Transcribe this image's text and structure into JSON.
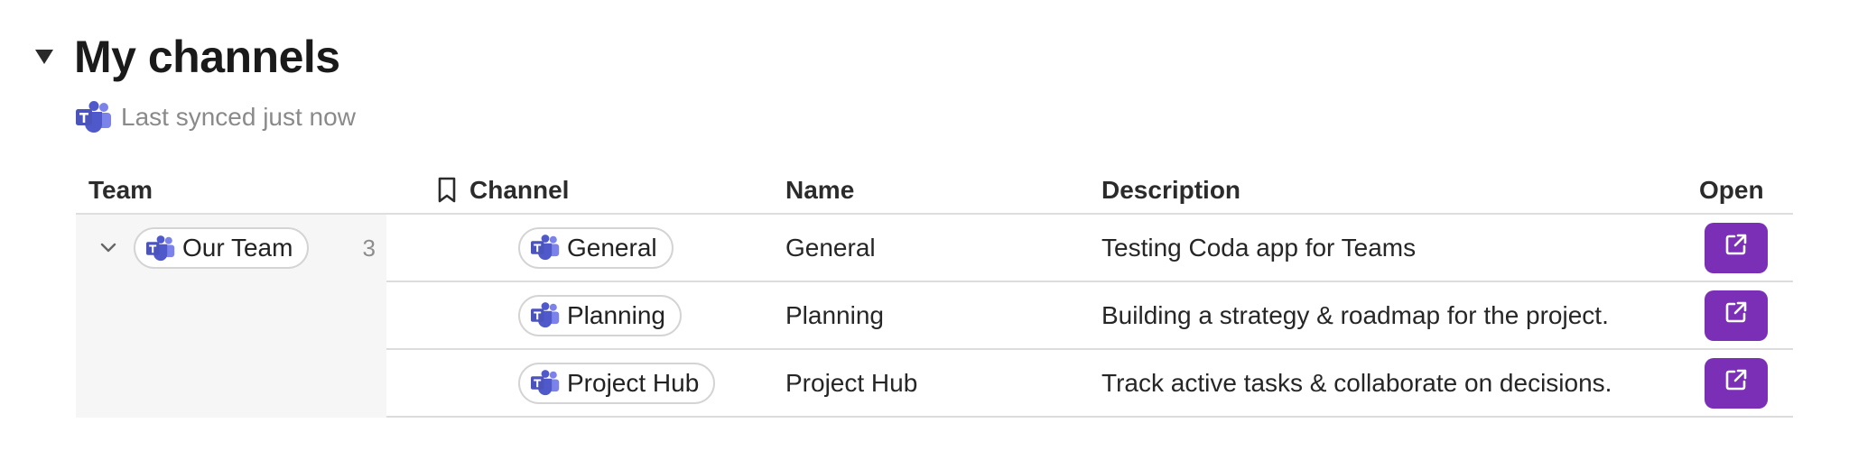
{
  "section": {
    "title": "My channels",
    "sync_status": "Last synced just now",
    "collapse_icon": "triangle-down-icon"
  },
  "colors": {
    "accent": "#7a2fb6",
    "teams_brand": "#5059c9",
    "muted_text": "#8a8a8a",
    "row_border": "#dcdcdc",
    "group_background": "#f6f6f6"
  },
  "table": {
    "headers": {
      "team": "Team",
      "channel": "Channel",
      "name": "Name",
      "description": "Description",
      "open": "Open"
    },
    "group": {
      "team": "Our Team",
      "count": "3",
      "expanded": true
    },
    "rows": [
      {
        "channel": "General",
        "name": "General",
        "description": "Testing Coda app for Teams",
        "open_icon": "external-link-icon"
      },
      {
        "channel": "Planning",
        "name": "Planning",
        "description": "Building a strategy & roadmap for the project.",
        "open_icon": "external-link-icon"
      },
      {
        "channel": "Project Hub",
        "name": "Project Hub",
        "description": "Track active tasks & collaborate on decisions.",
        "open_icon": "external-link-icon"
      }
    ]
  }
}
